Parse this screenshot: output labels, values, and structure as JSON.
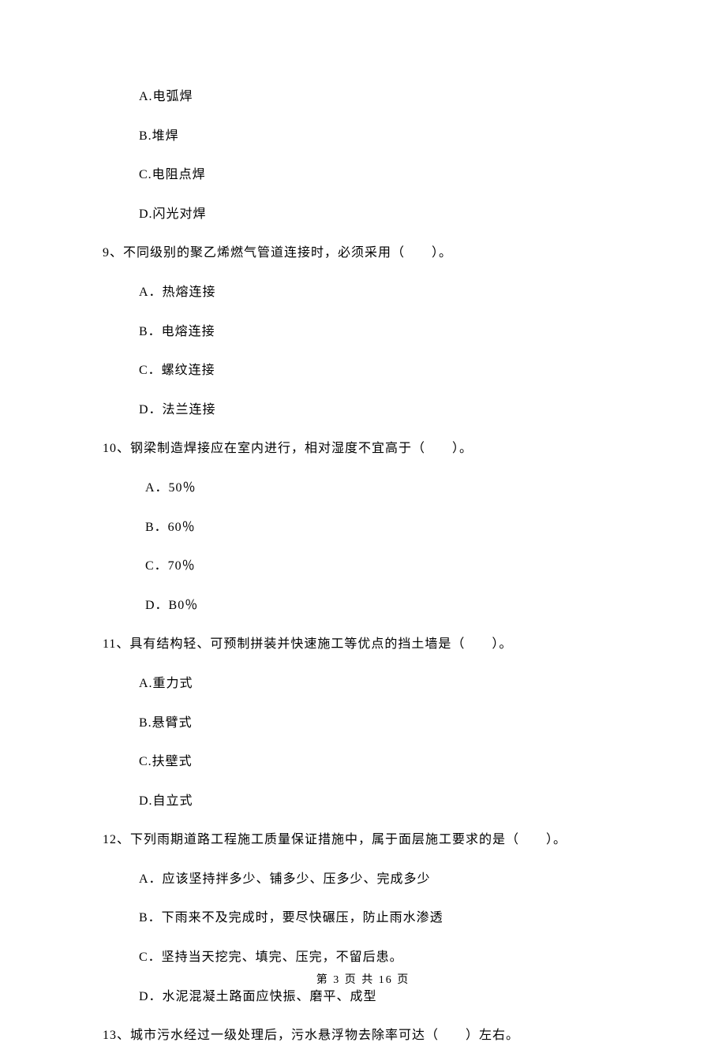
{
  "options_q8": {
    "a": "A.电弧焊",
    "b": "B.堆焊",
    "c": "C.电阻点焊",
    "d": "D.闪光对焊"
  },
  "q9": {
    "text": "9、不同级别的聚乙烯燃气管道连接时，必须采用（　　）。",
    "a": "A．热熔连接",
    "b": "B．电熔连接",
    "c": "C．螺纹连接",
    "d": "D．法兰连接"
  },
  "q10": {
    "text": "10、钢梁制造焊接应在室内进行，相对湿度不宜高于（　　）。",
    "a": "A．50％",
    "b": "B．60％",
    "c": "C．70％",
    "d": "D．B0％"
  },
  "q11": {
    "text": "11、具有结构轻、可预制拼装并快速施工等优点的挡土墙是（　　）。",
    "a": "A.重力式",
    "b": "B.悬臂式",
    "c": "C.扶壁式",
    "d": "D.自立式"
  },
  "q12": {
    "text": "12、下列雨期道路工程施工质量保证措施中，属于面层施工要求的是（　　）。",
    "a": "A．应该坚持拌多少、铺多少、压多少、完成多少",
    "b": "B．下雨来不及完成时，要尽快碾压，防止雨水渗透",
    "c": "C．坚持当天挖完、填完、压完，不留后患。",
    "d": "D．水泥混凝土路面应快振、磨平、成型"
  },
  "q13": {
    "text": "13、城市污水经过一级处理后，污水悬浮物去除率可达（　　）左右。"
  },
  "footer": "第 3 页 共 16 页"
}
